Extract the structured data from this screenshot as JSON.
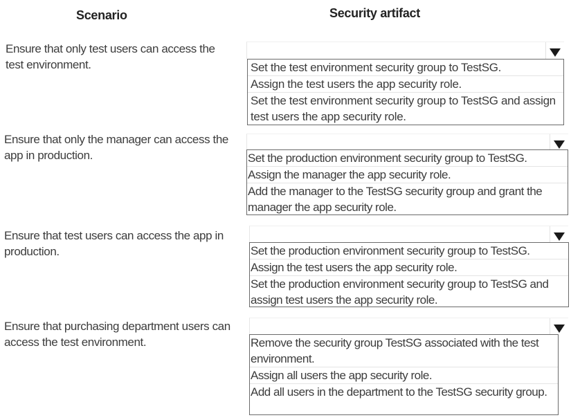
{
  "headers": {
    "scenario": "Scenario",
    "artifact": "Security artifact"
  },
  "rows": [
    {
      "scenario": "Ensure that only test users can access the test environment.",
      "selected": "",
      "options": [
        "Set the test environment security group to TestSG.",
        "Assign the test users the app security role.",
        "Set the test environment security group to TestSG and assign test users the app security role."
      ]
    },
    {
      "scenario": "Ensure that only the manager can access the app in production.",
      "selected": "",
      "options": [
        "Set the production environment security group to TestSG.",
        "Assign the manager the app security role.",
        "Add the manager to the TestSG security group and grant the manager the app security role."
      ]
    },
    {
      "scenario": "Ensure that test users can access the app in production.",
      "selected": "",
      "options": [
        "Set the production environment security group to TestSG.",
        "Assign the test users the app security role.",
        "Set the production environment security group to TestSG and assign test users the app security role."
      ]
    },
    {
      "scenario": "Ensure that purchasing department users can access the test environment.",
      "selected": "",
      "options": [
        "Remove the security group TestSG associated with the test environment.",
        "Assign all users the app security role.",
        "Add all users in the department to the TestSG security group."
      ]
    }
  ],
  "icons": {
    "dropdown": "chevron-down-icon"
  }
}
